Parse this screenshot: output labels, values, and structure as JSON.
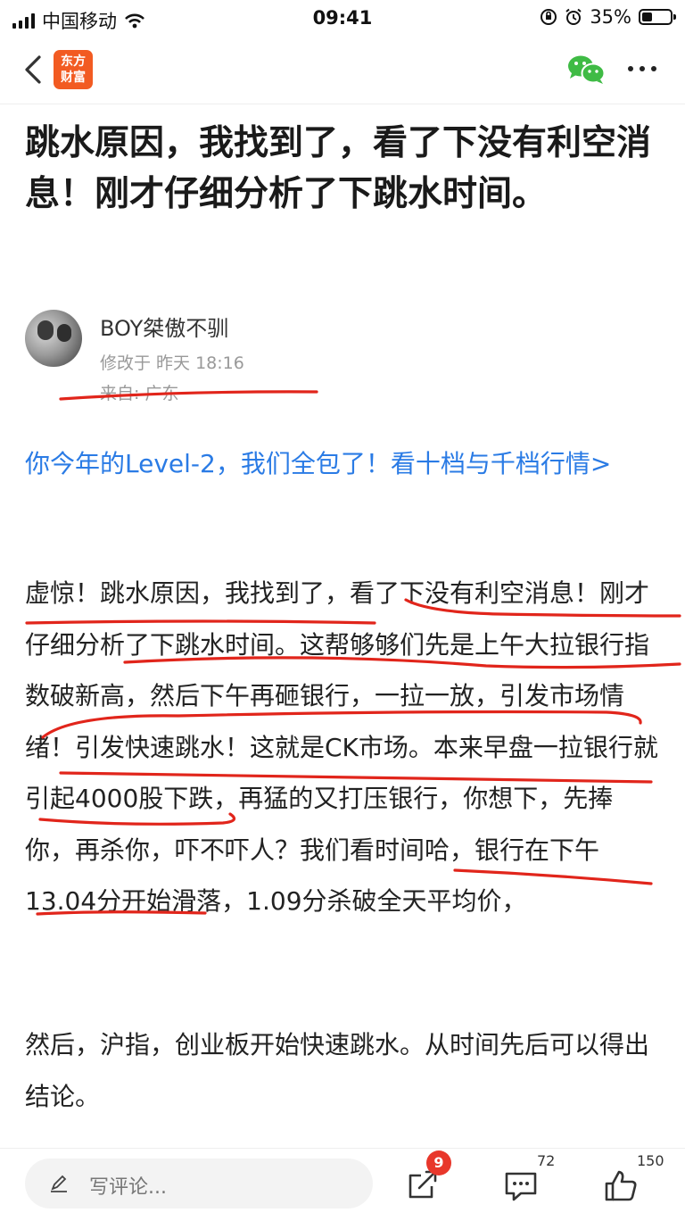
{
  "status_bar": {
    "carrier": "中国移动",
    "time": "09:41",
    "battery": "35%",
    "battery_level": 0.35
  },
  "nav": {
    "logo_line1": "东方",
    "logo_line2": "财富"
  },
  "article": {
    "title": "跳水原因，我找到了，看了下没有利空消息！刚才仔细分析了下跳水时间。",
    "author_name": "BOY桀傲不驯",
    "modified": "修改于 昨天 18:16",
    "from": "来自: 广东",
    "promo": "你今年的Level-2，我们全包了！看十档与千档行情>",
    "para1": "虚惊！跳水原因，我找到了，看了下没有利空消息！刚才仔细分析了下跳水时间。这帮够够们先是上午大拉银行指数破新高，然后下午再砸银行，一拉一放，引发市场情绪！引发快速跳水！这就是CK市场。本来早盘一拉银行就引起4000股下跌，再猛的又打压银行，你想下，先捧你，再杀你，吓不吓人？我们看时间哈，银行在下午13.04分开始滑落，1.09分杀破全天平均价，",
    "para2": "然后，沪指，创业板开始快速跳水。从时间先后可以得出结论。"
  },
  "bottom_bar": {
    "comment_placeholder": "写评论...",
    "share_badge": "9",
    "comment_count": "72",
    "like_count": "150"
  },
  "colors": {
    "link": "#2a7be5",
    "brand": "#f25b22",
    "ink": "#e1251b",
    "wechat": "#3fbb45"
  },
  "icons": [
    "back-icon",
    "wechat-icon",
    "more-icon",
    "pen-icon",
    "share-icon",
    "comment-icon",
    "like-icon"
  ]
}
